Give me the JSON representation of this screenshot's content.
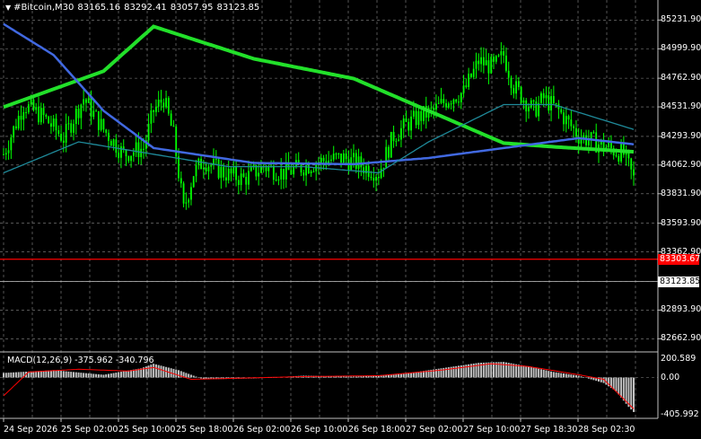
{
  "header": {
    "symbol": "#Bitcoin,M30",
    "open": "83165.16",
    "high": "83292.41",
    "low": "83057.95",
    "close": "83123.85"
  },
  "price_axis": {
    "labels": [
      "85231.90",
      "84999.90",
      "84762.90",
      "84531.90",
      "84293.90",
      "84062.90",
      "83831.90",
      "83593.90",
      "83362.90",
      "83123.85",
      "82893.90",
      "82662.90"
    ],
    "values": [
      85231.9,
      84999.9,
      84762.9,
      84531.9,
      84293.9,
      84062.9,
      83831.9,
      83593.9,
      83362.9,
      83123.85,
      82893.9,
      82662.9
    ]
  },
  "markers": {
    "red_line_label": "83303.67",
    "red_line_value": 83303.67,
    "red_color": "#ff0000",
    "current_label": "83123.85",
    "current_value": 83123.85
  },
  "macd": {
    "label": "MACD(12,26,9)",
    "main": "-375.962",
    "signal": "-340.796",
    "axis_labels": [
      "200.589",
      "0.00",
      "-405.992"
    ],
    "axis_values": [
      200.589,
      0,
      -405.992
    ]
  },
  "time_axis": [
    "24 Sep 2026",
    "25 Sep 02:00",
    "25 Sep 10:00",
    "25 Sep 18:00",
    "26 Sep 02:00",
    "26 Sep 10:00",
    "26 Sep 18:00",
    "27 Sep 02:00",
    "27 Sep 10:00",
    "27 Sep 18:30",
    "28 Sep 02:30"
  ],
  "colors": {
    "background": "#000000",
    "candles": "#00ff00",
    "ma_slow": "#22e02a",
    "ma_mid": "#4169e1",
    "ma_fast": "#1f8a9a",
    "grid": "#8a8a8a",
    "macd_hist": "#c0c0c0",
    "macd_signal": "#ff0000"
  },
  "chart_data": {
    "type": "candlestick",
    "symbol": "#Bitcoin",
    "timeframe": "M30",
    "price_range": [
      82600,
      85350
    ],
    "close_path": [
      [
        0,
        84150
      ],
      [
        8,
        84550
      ],
      [
        16,
        84450
      ],
      [
        24,
        84280
      ],
      [
        32,
        84600
      ],
      [
        40,
        84350
      ],
      [
        48,
        84150
      ],
      [
        56,
        84200
      ],
      [
        60,
        84500
      ],
      [
        64,
        84600
      ],
      [
        68,
        84300
      ],
      [
        72,
        83700
      ],
      [
        76,
        84000
      ],
      [
        80,
        84100
      ],
      [
        88,
        84000
      ],
      [
        96,
        83950
      ],
      [
        104,
        84050
      ],
      [
        112,
        84000
      ],
      [
        120,
        84050
      ],
      [
        128,
        84100
      ],
      [
        136,
        84120
      ],
      [
        144,
        84050
      ],
      [
        150,
        84000
      ],
      [
        156,
        84300
      ],
      [
        162,
        84400
      ],
      [
        166,
        84450
      ],
      [
        172,
        84500
      ],
      [
        178,
        84600
      ],
      [
        184,
        84650
      ],
      [
        190,
        84900
      ],
      [
        196,
        84850
      ],
      [
        200,
        84950
      ],
      [
        204,
        84700
      ],
      [
        208,
        84600
      ],
      [
        212,
        84500
      ],
      [
        216,
        84600
      ],
      [
        222,
        84500
      ],
      [
        230,
        84300
      ],
      [
        236,
        84250
      ],
      [
        242,
        84200
      ],
      [
        248,
        84150
      ],
      [
        252,
        83950
      ]
    ],
    "moving_averages": [
      {
        "values_path": [
          [
            0,
            84530
          ],
          [
            40,
            84820
          ],
          [
            60,
            85180
          ],
          [
            100,
            84920
          ],
          [
            140,
            84760
          ],
          [
            170,
            84500
          ],
          [
            200,
            84240
          ],
          [
            220,
            84210
          ],
          [
            252,
            84170
          ]
        ]
      },
      {
        "values_path": [
          [
            0,
            85200
          ],
          [
            20,
            84950
          ],
          [
            40,
            84500
          ],
          [
            60,
            84200
          ],
          [
            100,
            84080
          ],
          [
            140,
            84070
          ],
          [
            170,
            84120
          ],
          [
            200,
            84200
          ],
          [
            230,
            84280
          ],
          [
            252,
            84230
          ]
        ]
      },
      {
        "values_path": [
          [
            0,
            84000
          ],
          [
            30,
            84250
          ],
          [
            60,
            84150
          ],
          [
            90,
            84050
          ],
          [
            120,
            84050
          ],
          [
            150,
            84000
          ],
          [
            170,
            84250
          ],
          [
            200,
            84550
          ],
          [
            220,
            84550
          ],
          [
            252,
            84350
          ]
        ]
      }
    ],
    "macd_histogram_path": [
      [
        0,
        50
      ],
      [
        20,
        80
      ],
      [
        40,
        30
      ],
      [
        55,
        100
      ],
      [
        60,
        150
      ],
      [
        70,
        80
      ],
      [
        80,
        -20
      ],
      [
        100,
        -10
      ],
      [
        120,
        20
      ],
      [
        140,
        10
      ],
      [
        160,
        40
      ],
      [
        180,
        120
      ],
      [
        190,
        160
      ],
      [
        200,
        170
      ],
      [
        210,
        120
      ],
      [
        220,
        60
      ],
      [
        230,
        20
      ],
      [
        240,
        -60
      ],
      [
        245,
        -150
      ],
      [
        250,
        -320
      ],
      [
        252,
        -376
      ]
    ],
    "macd_signal_path": [
      [
        0,
        -200
      ],
      [
        10,
        60
      ],
      [
        30,
        90
      ],
      [
        50,
        70
      ],
      [
        60,
        110
      ],
      [
        75,
        -20
      ],
      [
        90,
        -10
      ],
      [
        120,
        10
      ],
      [
        150,
        20
      ],
      [
        175,
        80
      ],
      [
        195,
        150
      ],
      [
        210,
        120
      ],
      [
        230,
        30
      ],
      [
        240,
        -20
      ],
      [
        252,
        -341
      ]
    ]
  }
}
